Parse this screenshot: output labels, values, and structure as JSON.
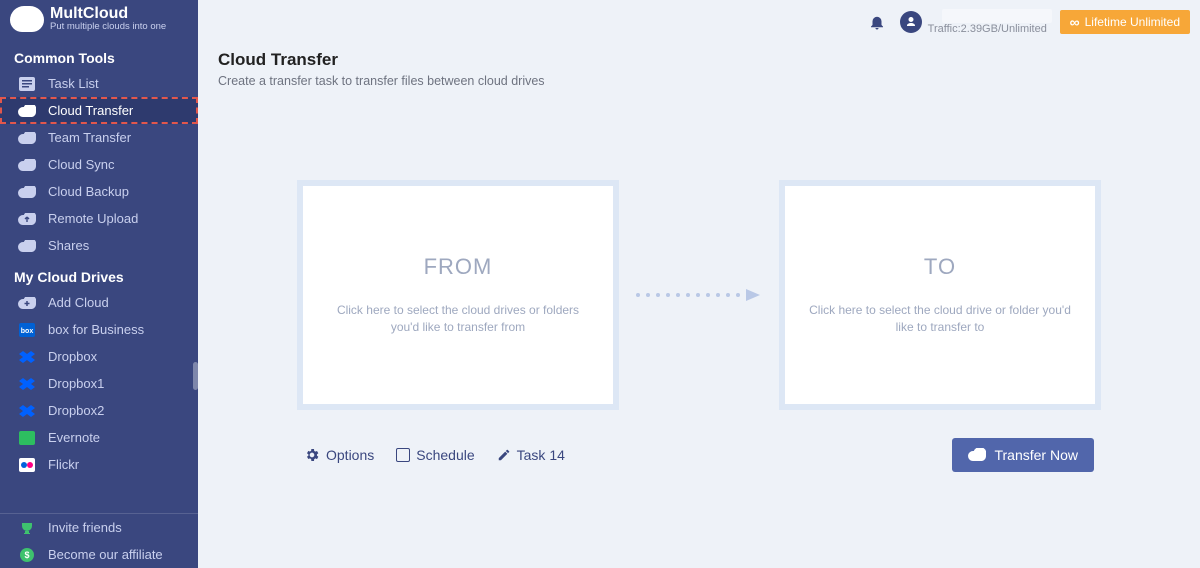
{
  "brand": {
    "name": "MultCloud",
    "tagline": "Put multiple clouds into one"
  },
  "topbar": {
    "traffic": "Traffic:2.39GB/Unlimited",
    "lifetime_label": "Lifetime Unlimited"
  },
  "sidebar": {
    "section_common": "Common Tools",
    "section_drives": "My Cloud Drives",
    "common_items": [
      {
        "label": "Task List",
        "icon": "list-icon"
      },
      {
        "label": "Cloud Transfer",
        "icon": "cloud-transfer-icon",
        "selected": true
      },
      {
        "label": "Team Transfer",
        "icon": "team-transfer-icon"
      },
      {
        "label": "Cloud Sync",
        "icon": "cloud-sync-icon"
      },
      {
        "label": "Cloud Backup",
        "icon": "cloud-backup-icon"
      },
      {
        "label": "Remote Upload",
        "icon": "cloud-upload-icon"
      },
      {
        "label": "Shares",
        "icon": "share-icon"
      }
    ],
    "drive_items": [
      {
        "label": "Add Cloud",
        "icon": "cloud-plus-icon"
      },
      {
        "label": "box for Business",
        "icon": "box-icon"
      },
      {
        "label": "Dropbox",
        "icon": "dropbox-icon"
      },
      {
        "label": "Dropbox1",
        "icon": "dropbox-icon"
      },
      {
        "label": "Dropbox2",
        "icon": "dropbox-icon"
      },
      {
        "label": "Evernote",
        "icon": "evernote-icon"
      },
      {
        "label": "Flickr",
        "icon": "flickr-icon"
      }
    ],
    "footer_items": [
      {
        "label": "Invite friends",
        "icon": "trophy-icon"
      },
      {
        "label": "Become our affiliate",
        "icon": "dollar-icon"
      }
    ]
  },
  "page": {
    "title": "Cloud Transfer",
    "subtitle": "Create a transfer task to transfer files between cloud drives",
    "from_label": "FROM",
    "from_desc": "Click here to select the cloud drives or folders you'd like to transfer from",
    "to_label": "TO",
    "to_desc": "Click here to select the cloud drive or folder you'd like to transfer to",
    "options_label": "Options",
    "schedule_label": "Schedule",
    "task_label": "Task 14",
    "transfer_now": "Transfer Now"
  }
}
